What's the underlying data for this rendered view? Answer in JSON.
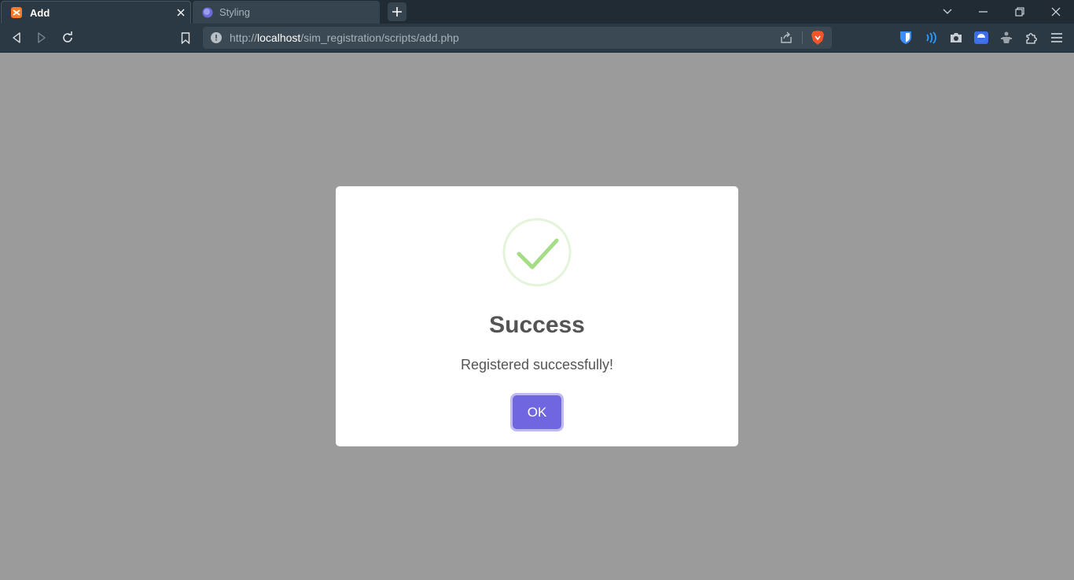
{
  "browser": {
    "tabs": [
      {
        "title": "Add",
        "active": true
      },
      {
        "title": "Styling",
        "active": false
      }
    ],
    "url": {
      "scheme": "http://",
      "host": "localhost",
      "path": "/sim_registration/scripts/add.php"
    },
    "icons": {
      "toolbar": [
        "back-icon",
        "forward-icon",
        "reload-icon",
        "bookmark-icon",
        "site-info-icon",
        "share-icon",
        "brave-shields-icon"
      ],
      "extensions": [
        "bitwarden-icon",
        "wireless-extension-icon",
        "camera-icon",
        "shield-extension-icon",
        "puzzle-extension-icon",
        "extensions-icon",
        "menu-icon"
      ]
    }
  },
  "dialog": {
    "title": "Success",
    "message": "Registered successfully!",
    "ok_label": "OK",
    "icon": "success-check-icon"
  },
  "colors": {
    "overlay": "#9b9b9b",
    "button": "#7066e0",
    "check": "#a5dc86",
    "tab_strip": "#202b33",
    "toolbar": "#2b3944"
  }
}
